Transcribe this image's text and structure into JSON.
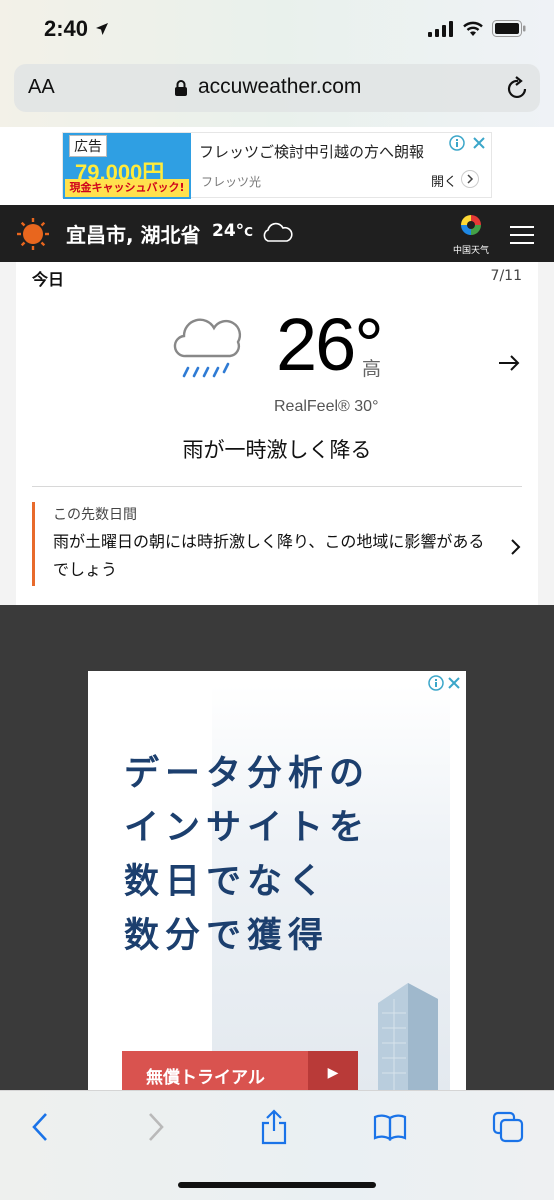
{
  "status_bar": {
    "time": "2:40"
  },
  "browser": {
    "text_size_label": "AA",
    "url": "accuweather.com"
  },
  "ad_top": {
    "badge": "広告",
    "price": "79,000円",
    "cash": "現金キャッシュバック!",
    "headline": "フレッツご検討中引越の方へ朗報",
    "sponsor": "フレッツ光",
    "open_label": "開く"
  },
  "header": {
    "location": "宜昌市, 湖北省",
    "temp": "24°",
    "temp_unit": "C",
    "logo_text": "中国天气"
  },
  "today": {
    "title": "今日",
    "date": "7/11",
    "temperature": "26°",
    "temperature_label": "高",
    "realfeel": "RealFeel® 30°",
    "phrase": "雨が一時激しく降る",
    "alert_label": "この先数日間",
    "alert_text": "雨が土曜日の朝には時折激しく降り、この地域に影響があるでしょう"
  },
  "ad_big": {
    "lines": [
      "データ分析の",
      "インサイトを",
      "数日でなく",
      "数分で獲得"
    ],
    "cta": "無償トライアル"
  },
  "colors": {
    "header_bg": "#1f1f1f",
    "sun": "#e8661e",
    "alert_bar": "#e86a2b",
    "ad_text": "#1c3f6e",
    "cta": "#d9534f",
    "ios_blue": "#1a73e8"
  },
  "icons": {
    "back": "chevron-left-icon",
    "forward": "chevron-right-icon",
    "share": "share-icon",
    "bookmarks": "book-icon",
    "tabs": "tabs-icon"
  }
}
